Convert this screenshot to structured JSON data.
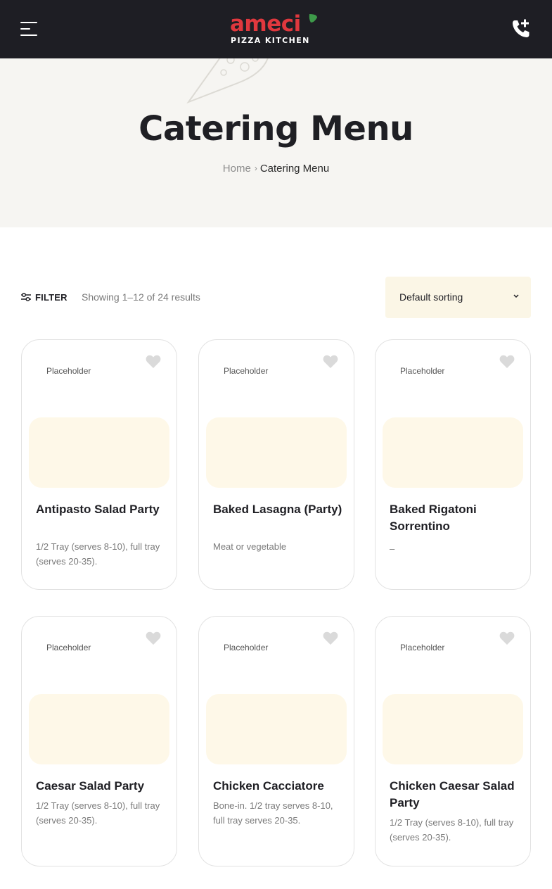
{
  "header": {
    "logo_word": "ameci",
    "logo_sub": "PIZZA KITCHEN",
    "brand_red": "#e0383e",
    "brand_green": "#3e9a4a"
  },
  "hero": {
    "title": "Catering Menu",
    "breadcrumb": {
      "home": "Home",
      "separator": "›",
      "current": "Catering Menu"
    }
  },
  "toolbar": {
    "filter_label": "FILTER",
    "result_count": "Showing 1–12 of 24 results",
    "sort": {
      "selected": "Default sorting"
    }
  },
  "products": [
    {
      "image_alt": "Placeholder",
      "title": "Antipasto Salad Party",
      "desc": "1/2 Tray (serves 8-10), full tray (serves 20-35)."
    },
    {
      "image_alt": "Placeholder",
      "title": "Baked Lasagna (Party)",
      "desc": "Meat or vegetable"
    },
    {
      "image_alt": "Placeholder",
      "title": "Baked Rigatoni Sorrentino",
      "desc": "–"
    },
    {
      "image_alt": "Placeholder",
      "title": "Caesar Salad Party",
      "desc": "1/2 Tray (serves 8-10), full tray (serves 20-35)."
    },
    {
      "image_alt": "Placeholder",
      "title": "Chicken Cacciatore",
      "desc": "Bone-in. 1/2 tray serves 8-10, full tray serves 20-35."
    },
    {
      "image_alt": "Placeholder",
      "title": "Chicken Caesar Salad Party",
      "desc": "1/2 Tray (serves 8-10), full tray (serves 20-35)."
    }
  ]
}
